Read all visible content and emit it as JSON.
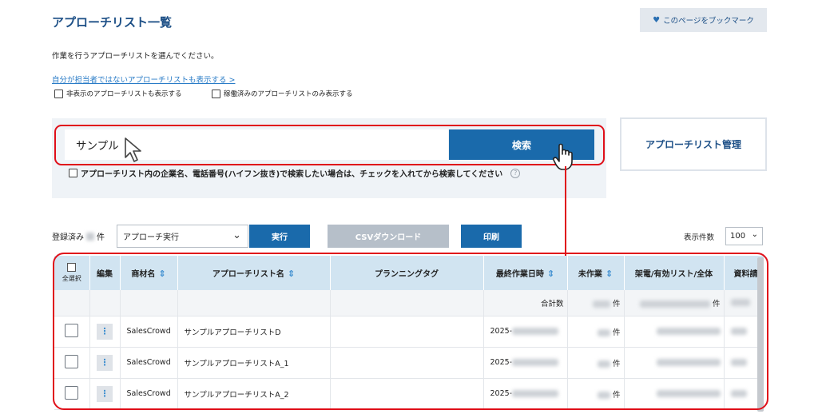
{
  "header": {
    "title": "アプローチリスト一覧",
    "bookmark_label": "このページをブックマーク"
  },
  "instruction": "作業を行うアプローチリストを選んでください。",
  "show_other_link": "自分が担当者ではないアプローチリストも表示する >",
  "filters": {
    "show_hidden_label": "非表示のアプローチリストも表示する",
    "show_active_only_label": "稼働済みのアプローチリストのみ表示する"
  },
  "search": {
    "value": "サンプル",
    "button_label": "検索",
    "note": "アプローチリスト内の企業名、電話番号(ハイフン抜き)で検索したい場合は、チェックを入れてから検索してください",
    "help": "?"
  },
  "manage_button_label": "アプローチリスト管理",
  "toolbar": {
    "registered_prefix": "登録済み",
    "registered_suffix": "件",
    "action_selected": "アプローチ実行",
    "run_label": "実行",
    "csv_label": "CSVダウンロード",
    "print_label": "印刷",
    "count_label": "表示件数",
    "count_value": "100"
  },
  "table": {
    "select_all": "全選択",
    "headers": {
      "edit": "編集",
      "product": "商材名",
      "list_name": "アプローチリスト名",
      "tag": "プランニングタグ",
      "last_work": "最終作業日時",
      "unworked": "未作業",
      "calls": "架電/有効リスト/全体",
      "materials": "資料請"
    },
    "sum_label": "合計数",
    "unit": "件",
    "rows": [
      {
        "product": "SalesCrowd",
        "name": "サンプルアプローチリストD",
        "date_prefix": "2025-"
      },
      {
        "product": "SalesCrowd",
        "name": "サンプルアプローチリストA_1",
        "date_prefix": "2025-"
      },
      {
        "product": "SalesCrowd",
        "name": "サンプルアプローチリストA_2",
        "date_prefix": "2025-"
      }
    ]
  },
  "colors": {
    "primary": "#1a6aab",
    "title": "#1c4f86",
    "highlight": "#e0101a",
    "table_header": "#d1e4f1"
  },
  "icons": {
    "bookmark": "heart-icon",
    "cursor": "mouse-pointer-icon",
    "hand": "hand-pointer-icon",
    "sort": "sort-arrows-icon",
    "edit": "vertical-dots-icon"
  }
}
